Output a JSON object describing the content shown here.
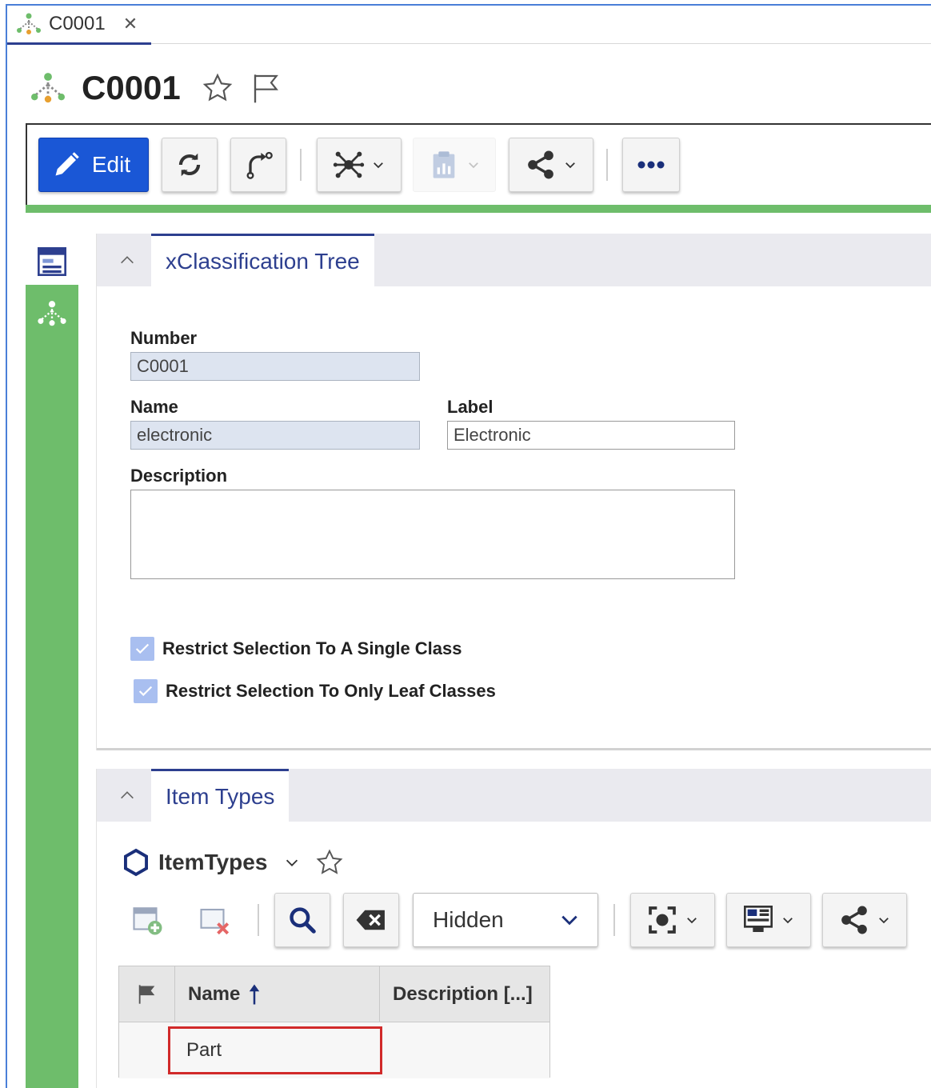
{
  "tab": {
    "label": "C0001",
    "close": "✕"
  },
  "title": "C0001",
  "toolbar": {
    "edit_label": "Edit"
  },
  "section1": {
    "title": "xClassification Tree",
    "number_label": "Number",
    "number_value": "C0001",
    "name_label": "Name",
    "name_value": "electronic",
    "label_label": "Label",
    "label_value": "Electronic",
    "description_label": "Description",
    "description_value": "",
    "checkbox1": "Restrict Selection To A Single Class",
    "checkbox2": "Restrict Selection To Only Leaf Classes"
  },
  "section2": {
    "title": "Item Types",
    "view_title": "ItemTypes",
    "filter_select": "Hidden",
    "columns": [
      "Name",
      "Description [...]"
    ],
    "rows": [
      {
        "name": "Part",
        "description": ""
      }
    ]
  },
  "colors": {
    "accent": "#1a57d6",
    "nav_green": "#6ebd6b",
    "tab_navy": "#2d3f8f",
    "highlight_red": "#d12a2a"
  }
}
